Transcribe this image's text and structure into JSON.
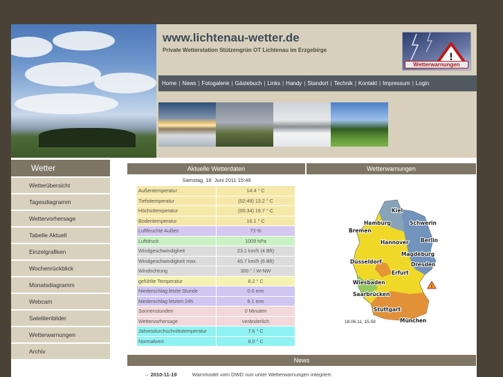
{
  "header": {
    "title": "www.lichtenau-wetter.de",
    "subtitle": "Private Wetterstation Stützengrün OT Lichtenau im Erzgebirge",
    "warn_logo_label": "Wetterwarnungen"
  },
  "nav": [
    "Home",
    "News",
    "Fotogalerie",
    "Gästebuch",
    "Links",
    "Handy",
    "Standort",
    "Technik",
    "Kontakt",
    "Impressum",
    "Login"
  ],
  "sidebar": {
    "heading": "Wetter",
    "items": [
      "Wetterübersicht",
      "Tagesdiagramm",
      "Wettervorhersage",
      "Tabelle Aktuell",
      "Einzelgrafiken",
      "Wochenrückblick",
      "Monatsdiagramm",
      "Webcam",
      "Satelitenbilder",
      "Wetterwarnungen",
      "Archiv"
    ]
  },
  "current": {
    "heading": "Aktuelle Wetterdaten",
    "date": "Samstag, 18. Juni 2011 15:49",
    "rows": [
      {
        "label": "Außentemperatur",
        "value": "14.4 ° C",
        "color": "#f6e8a8"
      },
      {
        "label": "Tiefsttemperatur",
        "value": "(02:49) 13.2 ° C",
        "color": "#f6e8a8"
      },
      {
        "label": "Höchsttemperatur",
        "value": "(00:34) 16.7 ° C",
        "color": "#f6e8a8"
      },
      {
        "label": "Bodentemperatur",
        "value": "16.1 ° C",
        "color": "#f6e8a8"
      },
      {
        "label": "Luftfeuchte Außen",
        "value": "73 %",
        "color": "#d4c8f2"
      },
      {
        "label": "Luftdruck",
        "value": "1009 hPa",
        "color": "#c8f2c4"
      },
      {
        "label": "Windgeschwindigkeit",
        "value": "23.1 km/h (4 Bft)",
        "color": "#dcdcdc"
      },
      {
        "label": "Windgeschwindigkeit max.",
        "value": "45.7 km/h (6 Bft)",
        "color": "#dcdcdc"
      },
      {
        "label": "Windrichtung",
        "value": "300 ° / W-NW",
        "color": "#dcdcdc"
      },
      {
        "label": "gefühlte Temperatur",
        "value": "8.2 ° C",
        "color": "#f6f2b2"
      },
      {
        "label": "Niederschlag letzte Stunde",
        "value": "0.0 mm",
        "color": "#cfc6f2"
      },
      {
        "label": "Niederschlag letzten 24h",
        "value": "6.1 mm",
        "color": "#cfc6f2"
      },
      {
        "label": "Sonnenstunden",
        "value": "0 Minuten",
        "color": "#f2d8da"
      },
      {
        "label": "Wettervorhersage",
        "value": "veränderlich",
        "color": "#f2d8da"
      },
      {
        "label": "Jahresdurchschnittstemperatur",
        "value": "7.6 ° C",
        "color": "#8ff2f2"
      },
      {
        "label": "Normalwert",
        "value": "8.0 ° C",
        "color": "#8ff2f2"
      }
    ]
  },
  "warnings": {
    "heading": "Wetterwarnungen",
    "cities": [
      "Kiel",
      "Hamburg",
      "Schwerin",
      "Bremen",
      "Hannover",
      "Berlin",
      "Magdeburg",
      "Düsseldorf",
      "Erfurt",
      "Dresden",
      "Wiesbaden",
      "Saarbrücken",
      "Stuttgart",
      "München"
    ],
    "timestamp": "18.06.11, 15.59"
  },
  "news": {
    "heading": "News",
    "date": "2010-11-19",
    "text": "Warnmodel vom DWD nun unter Wetterwarnungen integriert."
  }
}
